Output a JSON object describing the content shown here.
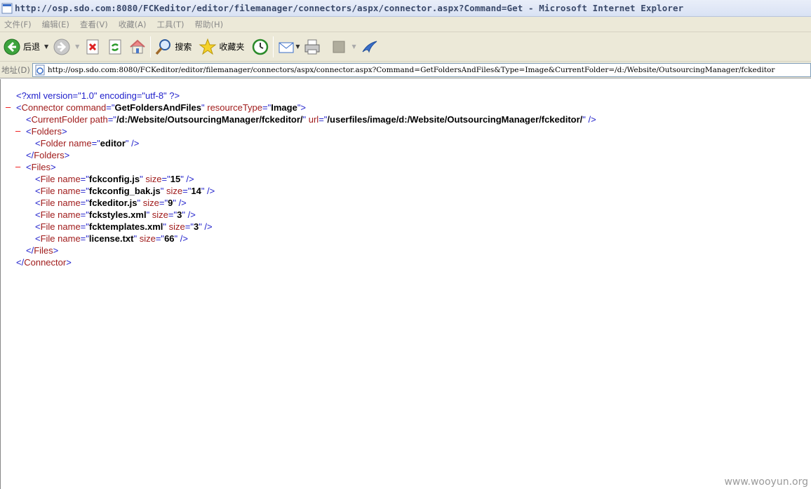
{
  "window": {
    "title": "http://osp.sdo.com:8080/FCKeditor/editor/filemanager/connectors/aspx/connector.aspx?Command=Get - Microsoft Internet Explorer"
  },
  "menu": [
    "文件(F)",
    "编辑(E)",
    "查看(V)",
    "收藏(A)",
    "工具(T)",
    "帮助(H)"
  ],
  "toolbar": {
    "back_label": "后退",
    "search_label": "搜索",
    "favorites_label": "收藏夹"
  },
  "address": {
    "label": "地址(D)",
    "url": "http://osp.sdo.com:8080/FCKeditor/editor/filemanager/connectors/aspx/connector.aspx?Command=GetFoldersAndFiles&Type=Image&CurrentFolder=/d:/Website/OutsourcingManager/fckeditor"
  },
  "xml": {
    "declaration": "<?xml version=\"1.0\" encoding=\"utf-8\" ?>",
    "connector": {
      "command": "GetFoldersAndFiles",
      "resourceType": "Image"
    },
    "current_folder": {
      "path": "/d:/Website/OutsourcingManager/fckeditor/",
      "url": "/userfiles/image/d:/Website/OutsourcingManager/fckeditor/"
    },
    "folders": [
      {
        "name": "editor"
      }
    ],
    "files": [
      {
        "name": "fckconfig.js",
        "size": "15"
      },
      {
        "name": "fckconfig_bak.js",
        "size": "14"
      },
      {
        "name": "fckeditor.js",
        "size": "9"
      },
      {
        "name": "fckstyles.xml",
        "size": "3"
      },
      {
        "name": "fcktemplates.xml",
        "size": "3"
      },
      {
        "name": "license.txt",
        "size": "66"
      }
    ]
  },
  "watermark": "www.wooyun.org"
}
